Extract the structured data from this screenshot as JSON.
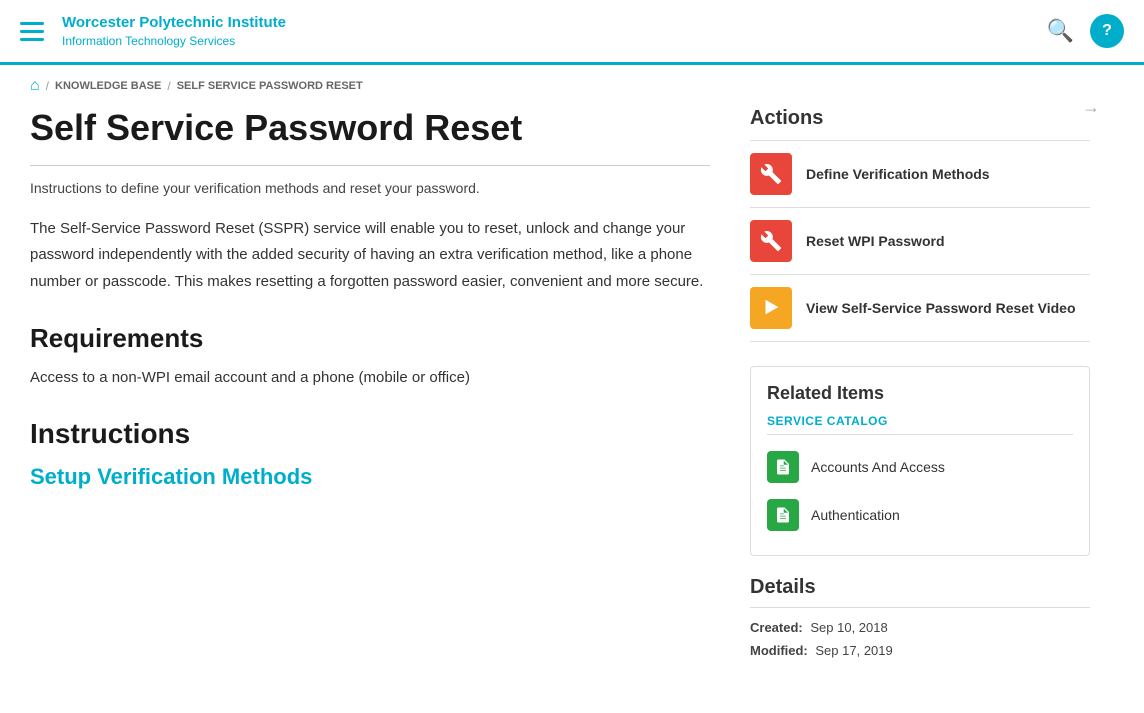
{
  "header": {
    "menu_icon": "☰",
    "org_name": "Worcester Polytechnic Institute",
    "org_sub": "Information Technology Services",
    "search_label": "search",
    "help_label": "?"
  },
  "breadcrumb": {
    "home_icon": "⌂",
    "separator": "/",
    "knowledge_base": "KNOWLEDGE BASE",
    "current": "SELF SERVICE PASSWORD RESET"
  },
  "article": {
    "title": "Self Service Password Reset",
    "intro": "Instructions to define your verification methods and reset your password.",
    "body": "The Self-Service Password Reset (SSPR) service will enable you to reset, unlock and change your password independently with the added security of having an extra verification method, like a phone number or passcode. This makes resetting a forgotten password easier, convenient and more secure.",
    "requirements_heading": "Requirements",
    "requirements_text": "Access to a non-WPI email account and a phone (mobile or office)",
    "instructions_heading": "Instructions",
    "setup_link": "Setup Verification Methods"
  },
  "sidebar": {
    "actions_title": "Actions",
    "actions": [
      {
        "id": "define-verification",
        "icon_type": "wrench",
        "icon_color": "red",
        "label": "Define Verification Methods"
      },
      {
        "id": "reset-wpi-password",
        "icon_type": "wrench",
        "icon_color": "red",
        "label": "Reset WPI Password"
      },
      {
        "id": "view-video",
        "icon_type": "arrow",
        "icon_color": "orange",
        "label": "View Self-Service Password Reset Video"
      }
    ],
    "related_items_title": "Related Items",
    "related_category": "Service Catalog",
    "related_items": [
      {
        "label": "Accounts And Access"
      },
      {
        "label": "Authentication"
      }
    ],
    "details_title": "Details",
    "created_label": "Created:",
    "created_value": "Sep 10, 2018",
    "modified_label": "Modified:",
    "modified_value": "Sep 17, 2019"
  }
}
